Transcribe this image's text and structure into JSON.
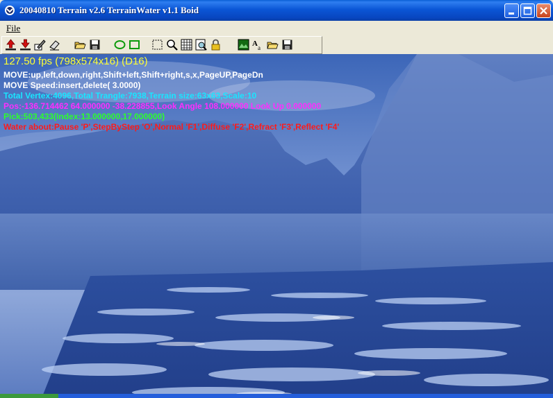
{
  "window": {
    "title": "20040810 Terrain v2.6 TerrainWater v1.1 Boid",
    "accent": "#0a56d6"
  },
  "menu": {
    "items": [
      "File"
    ]
  },
  "toolbar": {
    "groups": [
      [
        "upload-icon",
        "download-icon",
        "edit-icon",
        "eraser-icon"
      ],
      [
        "open-folder-icon",
        "save-disk-icon"
      ],
      [
        "ellipse-icon",
        "rectangle-icon"
      ],
      [
        "select-icon",
        "zoom-icon",
        "pattern-icon",
        "magnifier-page-icon",
        "lock-icon"
      ],
      [
        "image-icon",
        "font-icon",
        "open-folder-icon",
        "save-disk-icon"
      ]
    ]
  },
  "hud": {
    "fps": "127.50 fps (798x574x16) (D16)",
    "move": "MOVE:up,left,down,right,Shift+left,Shift+right,s,x,PageUP,PageDn",
    "speed": "MOVE Speed:insert,delete(  3.0000)",
    "stats": "Total Vertex:4096,Total Trangle:7938,Terrain size:63x63,Scale:10",
    "pos": "Pos:-136.714462 64.000000 -38.228855,Look Angle 108.000000 Look Up 0.000000",
    "pick": "Pick:503,433(Index:13.000000,17.000000)",
    "water": "Water about:Pause 'P',StepByStep 'O',Normal 'F1',Diffuse 'F2',Refract 'F3',Reflect 'F4'",
    "colors": {
      "fps": "#ffff33",
      "white": "#ffffff",
      "cyan": "#19e6ff",
      "magenta": "#ff2cff",
      "green": "#2cff2c",
      "red": "#ff1a1a"
    }
  }
}
